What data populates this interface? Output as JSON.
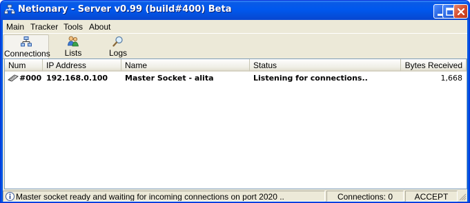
{
  "window": {
    "title": "Netionary - Server v0.99 (build#400) Beta",
    "title_color": "#ffffff",
    "controls": [
      "minimize-icon",
      "maximize-icon",
      "close-icon"
    ]
  },
  "menu": {
    "items": [
      "Main",
      "Tracker",
      "Tools",
      "About"
    ]
  },
  "toolbar": {
    "buttons": [
      {
        "label": "Connections",
        "icon": "network-icon",
        "active": true
      },
      {
        "label": "Lists",
        "icon": "users-icon",
        "active": false
      },
      {
        "label": "Logs",
        "icon": "magnifier-icon",
        "active": false
      }
    ]
  },
  "table": {
    "columns": [
      "Num",
      "IP Address",
      "Name",
      "Status",
      "Bytes Received"
    ],
    "rows": [
      {
        "num": "#000",
        "ip": "192.168.0.100",
        "name": "Master Socket - alita",
        "status": "Listening for connections..",
        "bytes": "1,668",
        "icon": "socket-icon"
      }
    ]
  },
  "statusbar": {
    "message": "Master socket ready and waiting for incoming connections on port 2020 ..",
    "message_icon": "info-icon",
    "connections": "Connections: 0",
    "mode": "ACCEPT"
  }
}
